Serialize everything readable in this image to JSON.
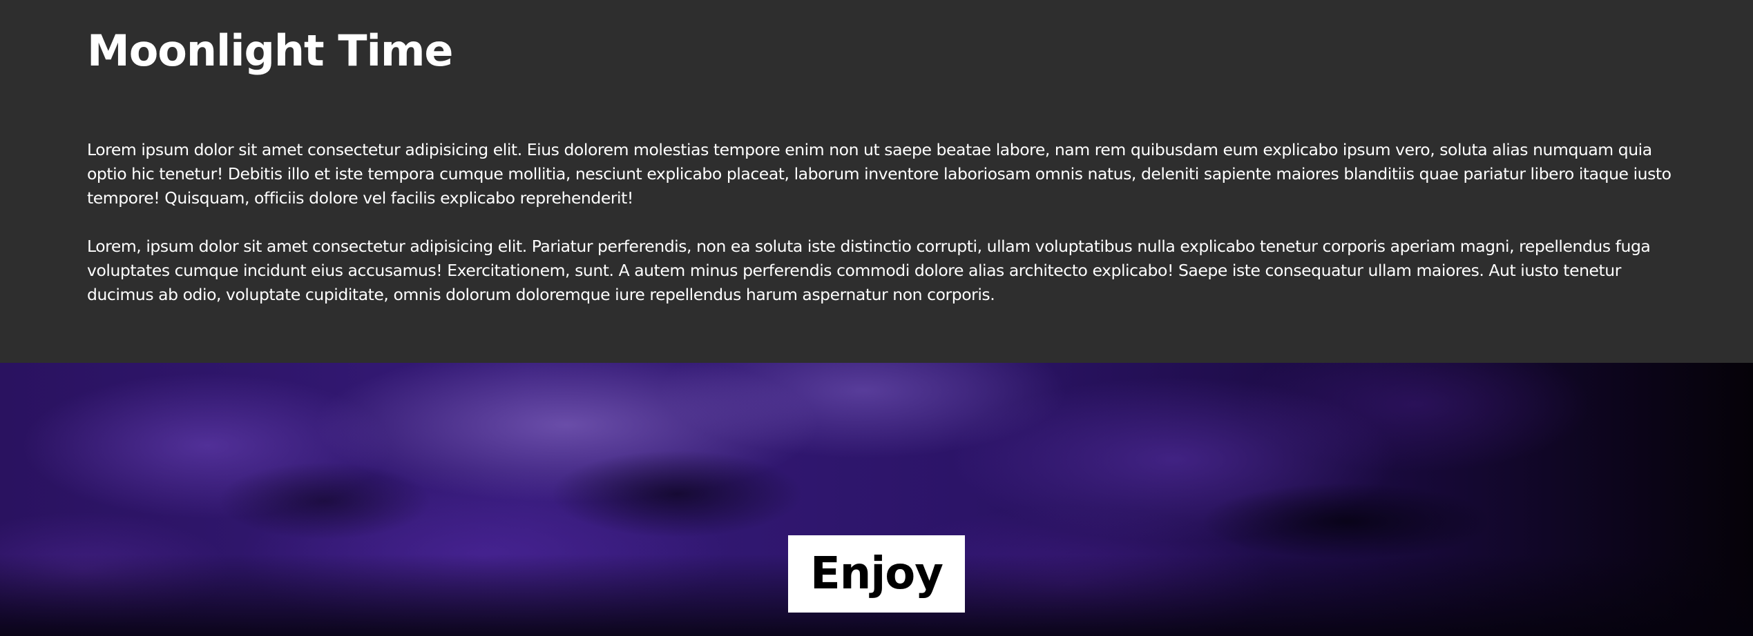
{
  "section": {
    "title": "Moonlight Time",
    "paragraphs": [
      "Lorem ipsum dolor sit amet consectetur adipisicing elit. Eius dolorem molestias tempore enim non ut saepe beatae labore, nam rem quibusdam eum explicabo ipsum vero, soluta alias numquam quia optio hic tenetur! Debitis illo et iste tempora cumque mollitia, nesciunt explicabo placeat, laborum inventore laboriosam omnis natus, deleniti sapiente maiores blanditiis quae pariatur libero itaque iusto tempore! Quisquam, officiis dolore vel facilis explicabo reprehenderit!",
      "Lorem, ipsum dolor sit amet consectetur adipisicing elit. Pariatur perferendis, non ea soluta iste distinctio corrupti, ullam voluptatibus nulla explicabo tenetur corporis aperiam magni, repellendus fuga voluptates cumque incidunt eius accusamus! Exercitationem, sunt. A autem minus perferendis commodi dolore alias architecto explicabo! Saepe iste consequatur ullam maiores. Aut iusto tenetur ducimus ab odio, voluptate cupiditate, omnis dolorum doloremque iure repellendus harum aspernatur non corporis."
    ]
  },
  "hero": {
    "label": "Enjoy"
  },
  "colors": {
    "section_background": "#2e2e2e",
    "text": "#ffffff",
    "hero_purple": "#351a78",
    "label_box": "#ffffff",
    "label_text": "#000000"
  }
}
